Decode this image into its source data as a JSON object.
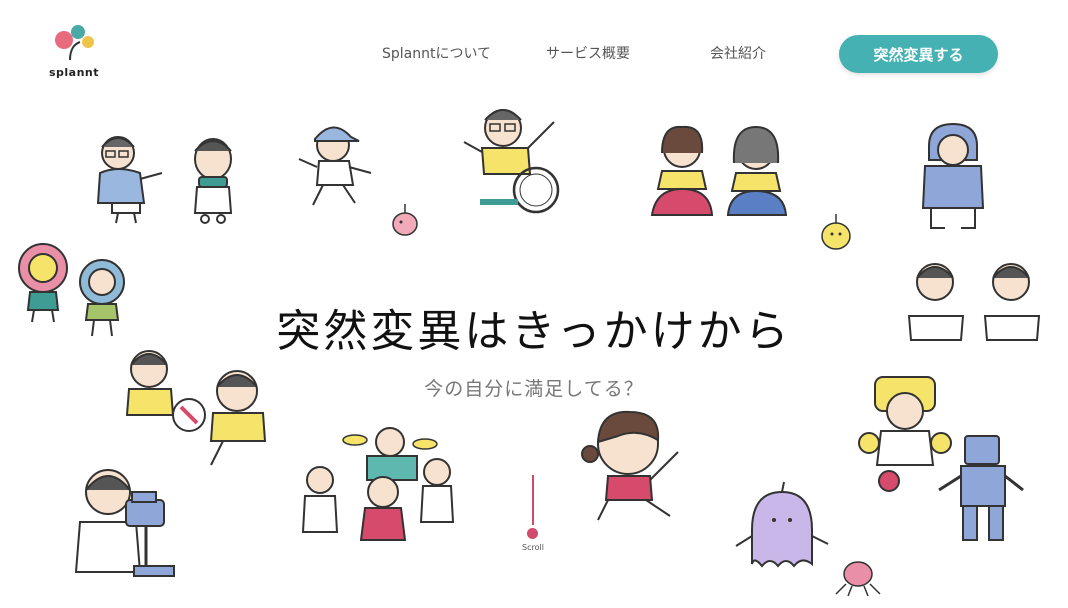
{
  "logo": {
    "text": "splannt"
  },
  "nav": {
    "items": [
      {
        "label": "Splanntについて"
      },
      {
        "label": "サービス概要"
      },
      {
        "label": "会社紹介"
      }
    ],
    "cta_label": "突然変異する"
  },
  "hero": {
    "title": "突然変異はきっかけから",
    "subtitle": "今の自分に満足してる？"
  },
  "scroll": {
    "label": "Scroll"
  },
  "colors": {
    "accent": "#45b1b3",
    "scroll_accent": "#d04a6c",
    "logo_pink": "#e76a7d",
    "logo_teal": "#4aa9a6",
    "logo_yellow": "#f0c34a"
  },
  "illustrations": [
    "man-with-glasses-sitting",
    "boy-with-scarf",
    "boy-in-cap-walking",
    "pink-creature",
    "man-in-wheelchair",
    "two-women-drinking-tea",
    "baby-in-blue-suit",
    "yellow-creature",
    "flower-girl",
    "flower-kid",
    "two-students-writing",
    "kids-playing-soccer",
    "drummer-band",
    "girl-running",
    "robot-kid",
    "blue-robot",
    "purple-ghost",
    "pink-octopus",
    "man-with-camera"
  ]
}
